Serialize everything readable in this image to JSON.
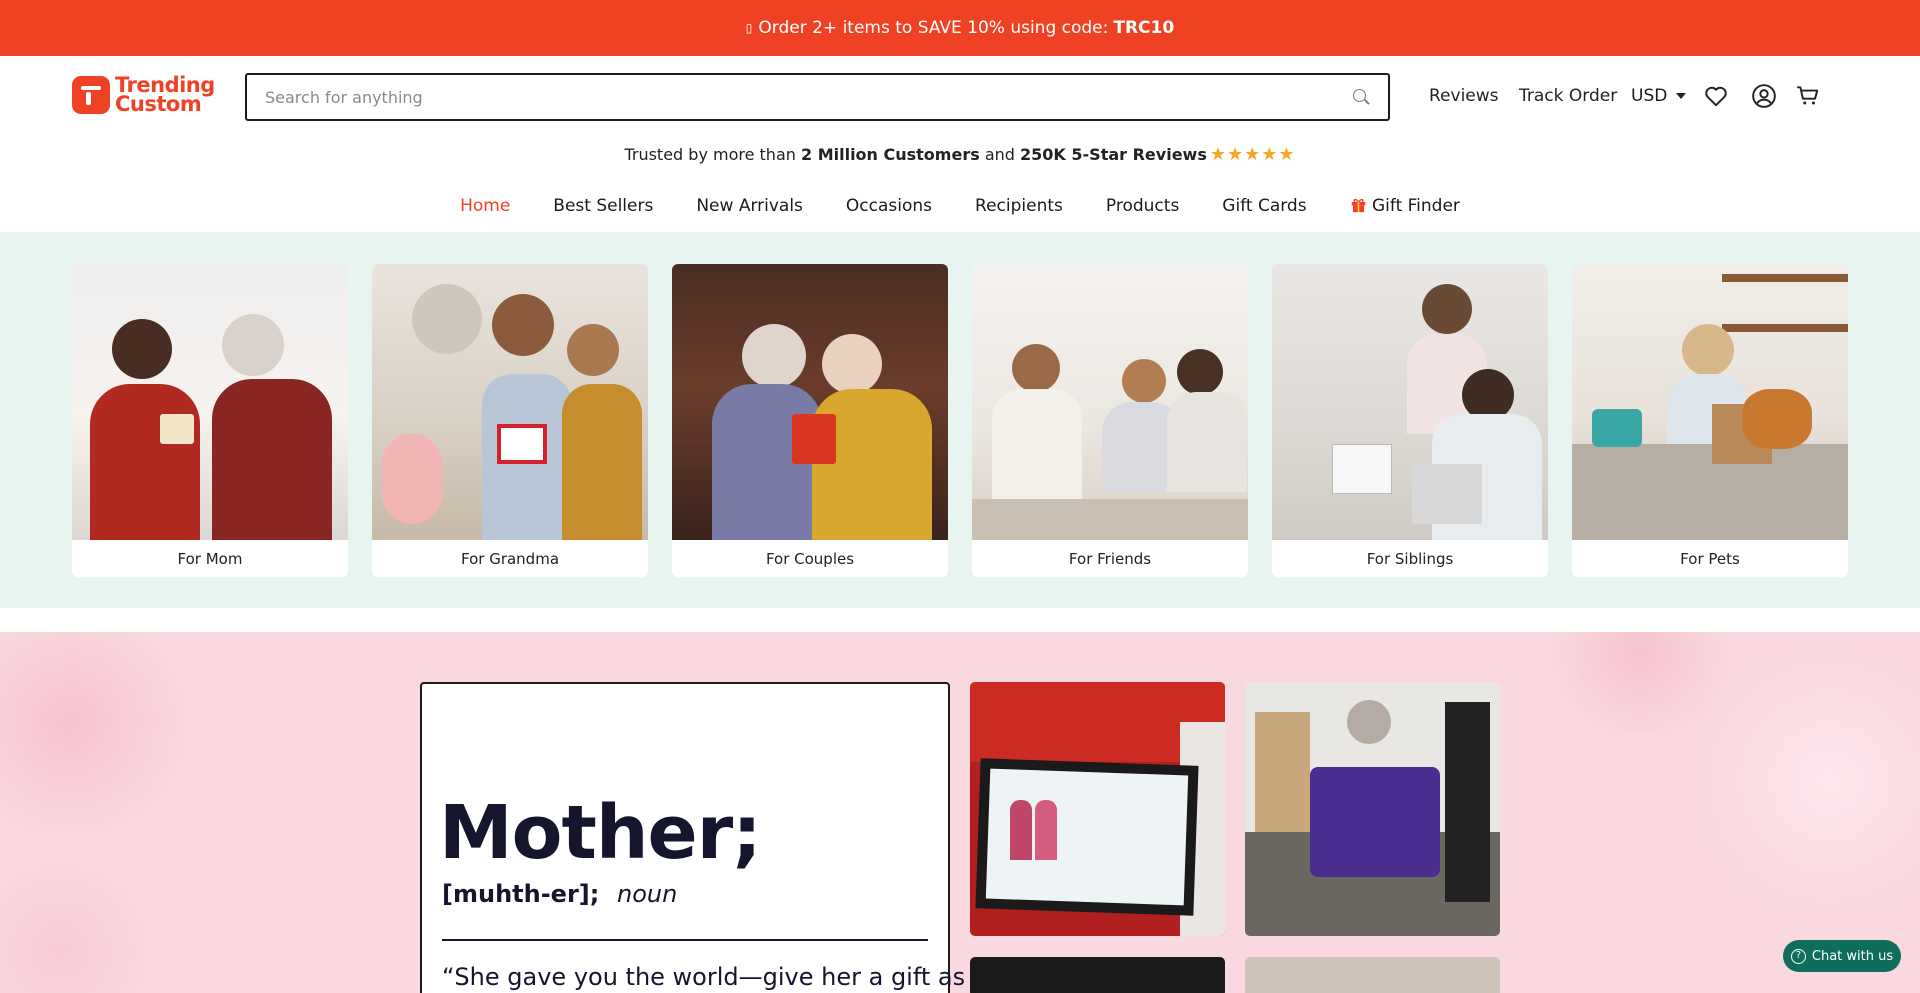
{
  "promo": {
    "text": "Order 2+ items to SAVE 10% using code:",
    "code": "TRC10"
  },
  "header": {
    "logo_line1": "Trending",
    "logo_line2": "Custom",
    "search_placeholder": "Search for anything",
    "links": {
      "reviews": "Reviews",
      "track_order": "Track Order"
    },
    "currency": "USD"
  },
  "trust": {
    "prefix": "Trusted by more than",
    "customers": "2 Million Customers",
    "middle": "and",
    "reviews": "250K 5-Star Reviews",
    "stars": "★★★★★"
  },
  "nav": {
    "home": "Home",
    "best_sellers": "Best Sellers",
    "new_arrivals": "New Arrivals",
    "occasions": "Occasions",
    "recipients": "Recipients",
    "products": "Products",
    "gift_cards": "Gift Cards",
    "gift_finder": "Gift Finder"
  },
  "recipients": [
    {
      "label": "For Mom"
    },
    {
      "label": "For Grandma"
    },
    {
      "label": "For Couples"
    },
    {
      "label": "For Friends"
    },
    {
      "label": "For Siblings"
    },
    {
      "label": "For Pets"
    }
  ],
  "mothers_day": {
    "word": "Mother;",
    "pronunciation": "[muhth-er];",
    "part_of_speech": "noun",
    "quote": "“She gave you the world—give her a gift as"
  },
  "chat": {
    "label": "Chat with us"
  },
  "colors": {
    "brand": "#ef4123",
    "band": "#e7f4ef",
    "pink": "#f9d9df",
    "chat": "#0f6d5e"
  }
}
